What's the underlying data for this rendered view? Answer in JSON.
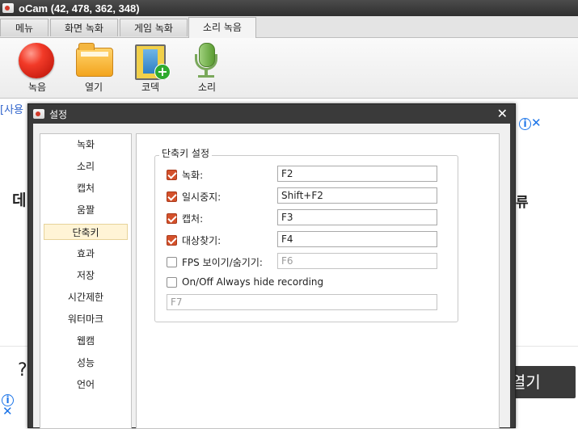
{
  "window": {
    "title": "oCam (42, 478, 362, 348)"
  },
  "tabs": [
    {
      "label": "메뉴"
    },
    {
      "label": "화면 녹화"
    },
    {
      "label": "게임 녹화"
    },
    {
      "label": "소리 녹음"
    }
  ],
  "toolbar": {
    "record": {
      "label": "녹음",
      "icon": "record-icon"
    },
    "open": {
      "label": "열기",
      "icon": "folder-icon"
    },
    "codec": {
      "label": "코덱",
      "icon": "codec-icon"
    },
    "sound": {
      "label": "소리",
      "icon": "microphone-icon"
    }
  },
  "background_page": {
    "link_text": "[사용",
    "heading_left": "데",
    "heading_right": "류",
    "bottom_char": "?",
    "open_button": "열기"
  },
  "dialog": {
    "title": "설정",
    "nav": [
      {
        "label": "녹화"
      },
      {
        "label": "소리"
      },
      {
        "label": "캡처"
      },
      {
        "label": "움짤"
      },
      {
        "label": "단축키"
      },
      {
        "label": "효과"
      },
      {
        "label": "저장"
      },
      {
        "label": "시간제한"
      },
      {
        "label": "워터마크"
      },
      {
        "label": "웹캠"
      },
      {
        "label": "성능"
      },
      {
        "label": "언어"
      }
    ],
    "selected_nav": "단축키",
    "group_title": "단축키 설정",
    "hotkeys": [
      {
        "label": "녹화:",
        "checked": true,
        "value": "F2"
      },
      {
        "label": "일시중지:",
        "checked": true,
        "value": "Shift+F2"
      },
      {
        "label": "캡처:",
        "checked": true,
        "value": "F3"
      },
      {
        "label": "대상찾기:",
        "checked": true,
        "value": "F4"
      },
      {
        "label": "FPS 보이기/숨기기:",
        "checked": false,
        "value": "F6"
      }
    ],
    "always_hide": {
      "label": "On/Off Always hide recording",
      "checked": false,
      "value": "F7"
    }
  },
  "colors": {
    "checkbox_checked": "#d4512b",
    "titlebar": "#3a3a3a",
    "link": "#3366cc",
    "ad_icon": "#1a73e8"
  }
}
